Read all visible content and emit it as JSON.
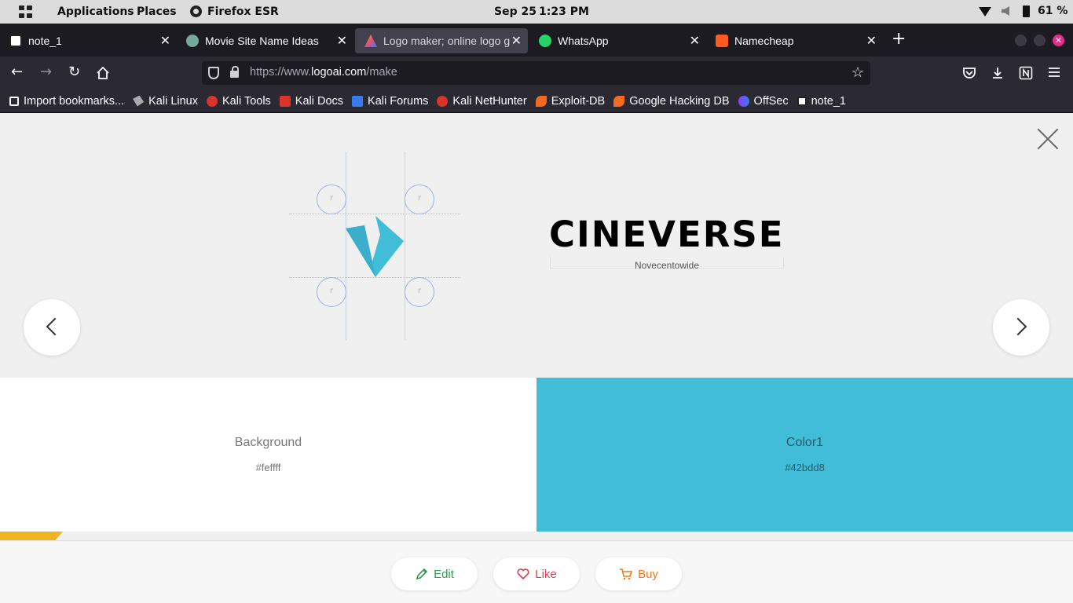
{
  "system": {
    "applications_label": "Applications",
    "places_label": "Places",
    "active_app_label": "Firefox ESR",
    "date": "Sep 25",
    "time": "1:23 PM",
    "battery": "61 %"
  },
  "tabs": [
    {
      "label": "note_1",
      "favicon": "notion-icon",
      "color": "#ffffff"
    },
    {
      "label": "Movie Site Name Ideas",
      "favicon": "chatgpt-icon",
      "color": "#74aa9c"
    },
    {
      "label": "Logo maker; online logo g",
      "favicon": "logoai-icon",
      "color": "#e94e77",
      "active": true
    },
    {
      "label": "WhatsApp",
      "favicon": "whatsapp-icon",
      "color": "#25d366"
    },
    {
      "label": "Namecheap",
      "favicon": "namecheap-icon",
      "color": "#ff5a1f"
    }
  ],
  "address_bar": {
    "url_prefix": "https://www.",
    "url_domain": "logoai.com",
    "url_path": "/make"
  },
  "bookmarks": [
    {
      "label": "Import bookmarks...",
      "icon": "import-icon",
      "color": "#fbfbfe"
    },
    {
      "label": "Kali Linux",
      "icon": "kali-dragon-icon",
      "color": "#aaaaaa"
    },
    {
      "label": "Kali Tools",
      "icon": "kali-tools-icon",
      "color": "#d9342b"
    },
    {
      "label": "Kali Docs",
      "icon": "kali-docs-icon",
      "color": "#d9342b"
    },
    {
      "label": "Kali Forums",
      "icon": "kali-forums-icon",
      "color": "#367bf0"
    },
    {
      "label": "Kali NetHunter",
      "icon": "kali-nethunter-icon",
      "color": "#d9342b"
    },
    {
      "label": "Exploit-DB",
      "icon": "exploitdb-icon",
      "color": "#f26b21"
    },
    {
      "label": "Google Hacking DB",
      "icon": "ghdb-icon",
      "color": "#f26b21"
    },
    {
      "label": "OffSec",
      "icon": "offsec-icon",
      "color": "#8a3ffc"
    },
    {
      "label": "note_1",
      "icon": "notion-icon",
      "color": "#ffffff"
    }
  ],
  "preview": {
    "brand_name": "CINEVERSE",
    "font_name": "Novecentowide",
    "grid_marker": "r",
    "mark_color": "#42bdd8"
  },
  "palette": [
    {
      "name": "Background",
      "hex": "#feffff",
      "swatch": "#ffffff",
      "text": "#777777"
    },
    {
      "name": "Color1",
      "hex": "#42bdd8",
      "swatch": "#42bdd8",
      "text": "#2a5a68"
    }
  ],
  "actions": {
    "edit": {
      "label": "Edit",
      "color": "#2e9b4e"
    },
    "like": {
      "label": "Like",
      "color": "#e53950"
    },
    "buy": {
      "label": "Buy",
      "color": "#f07a1a"
    }
  }
}
